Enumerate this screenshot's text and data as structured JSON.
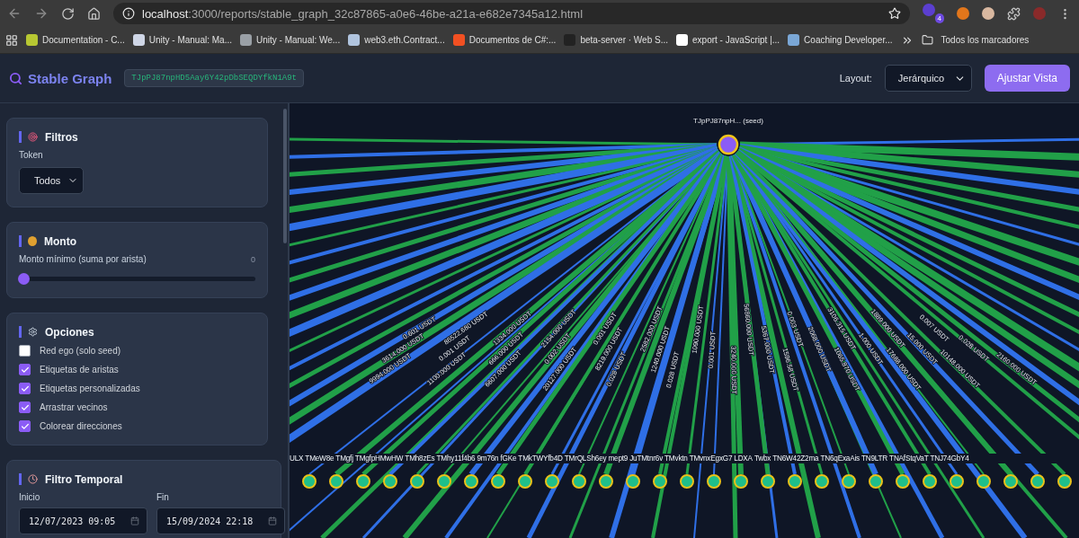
{
  "browser": {
    "url_host": "localhost",
    "url_path": ":3000/reports/stable_graph_32c87865-a0e6-46be-a21a-e682e7345a12.html",
    "extension_badge": "4",
    "bookmarks": [
      "Documentation - C...",
      "Unity - Manual: Ma...",
      "Unity - Manual: We...",
      "web3.eth.Contract...",
      "Documentos de C#:...",
      "beta-server · Web S...",
      "export - JavaScript |...",
      "Coaching Developer..."
    ],
    "all_bookmarks": "Todos los marcadores"
  },
  "header": {
    "title": "Stable Graph",
    "address": "TJpPJ87npHD5Aay6Y42pDbSEQDYfkN1A9t",
    "layout_label": "Layout:",
    "layout_value": "Jerárquico",
    "fit_button": "Ajustar Vista"
  },
  "filters": {
    "title": "Filtros",
    "token_label": "Token",
    "token_value": "Todos"
  },
  "amount": {
    "title": "Monto",
    "label": "Monto mínimo (suma por arista)",
    "reading": "0",
    "level": 0
  },
  "options": {
    "title": "Opciones",
    "items": [
      {
        "label": "Red ego (solo seed)",
        "checked": false
      },
      {
        "label": "Etiquetas de aristas",
        "checked": true
      },
      {
        "label": "Etiquetas personalizadas",
        "checked": true
      },
      {
        "label": "Arrastrar vecinos",
        "checked": true
      },
      {
        "label": "Colorear direcciones",
        "checked": true
      }
    ]
  },
  "time_filter": {
    "title": "Filtro Temporal",
    "start_label": "Inicio",
    "start_value": "12/07/2023 09:05",
    "end_label": "Fin",
    "end_value": "15/09/2024 22:18"
  },
  "graph": {
    "seed_label": "TJpPJ87npH... (seed)",
    "node_labels": [
      "ULX",
      "TMeW8e",
      "TMgfj",
      "TMgfpHMwHW",
      "TMh8zEs",
      "TMhy11f4b6",
      "9m76n",
      "fGKe",
      "TMkTWYfb4D",
      "TMrQLSh6ey",
      "mept9",
      "JuTMtnr6v",
      "TMvktn",
      "TMvnxEgxG7",
      "LDXA",
      "Twbx",
      "TN6W42Z2ma",
      "TN6qExaAis",
      "TN9LTR",
      "TNAfStqVaT",
      "TNJ74GbY4"
    ],
    "edge_labels": [
      "0.601 USDT",
      "3614.000 USDT",
      "9994.000 USDT",
      "86522.680 USDT",
      "0.001 USDT",
      "1100.000 USDT",
      "1334.000 USDT",
      "666.000 USDT",
      "6607.000 USDT",
      "2154.000 USDT",
      "0.002 USDT",
      "20127.000 USDT",
      "0.001 USDT",
      "8219.000 USDT",
      "0.028 USDT",
      "2582.000 USDT",
      "1240.000 USDT",
      "0.028 USDT",
      "1090.000 USDT",
      "0.001 USDT",
      "3240.000 USDT",
      "56860.000 USDT",
      "5367.000 USDT",
      "1596.58 USDT",
      "0.003 USDT",
      "2068.000 USDT",
      "1065.870 USDT",
      "3106.315 USDT",
      "1.000 USDT",
      "17688.000 USDT",
      "1889.000 USDT",
      "15.000 USDT",
      "10148.000 USDT",
      "0.007 USDT",
      "0.028 USDT",
      "2160.000 USDT"
    ]
  }
}
